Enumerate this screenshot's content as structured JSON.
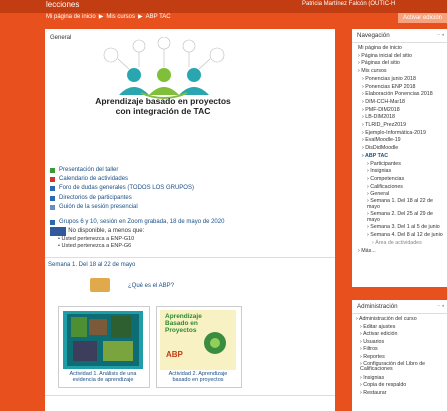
{
  "header": {
    "site_name": "lecciones",
    "user_name": "Patricia Martínez Falcón (OUTIC-H",
    "edit_button": "Activar edición",
    "breadcrumb": [
      "Mi página de inicio",
      "▶",
      "Mis cursos",
      "▶",
      "ABP TAC"
    ]
  },
  "main": {
    "general_title": "General",
    "hero_title_line1": "Aprendizaje basado en proyectos",
    "hero_title_line2": "con integración de TAC",
    "activities": [
      {
        "label": "Presentación del taller",
        "icon": "green"
      },
      {
        "label": "Calendario de actividades",
        "icon": "red"
      },
      {
        "label": "Foro de dudas generales   (TODOS LOS GRUPOS)",
        "icon": "blue"
      },
      {
        "label": "Directorios de participantes",
        "icon": "blue"
      },
      {
        "label": "Guión de la sesión presencial",
        "icon": "blue"
      }
    ],
    "highlighted_line": "Grupos 6 y 10, sesión en Zoom grabada, 18 de mayo de 2020",
    "restricted_line": "No disponible, a menos que:",
    "restrictions": [
      "Usted pertenezca a ENP-G10",
      "Usted pertenezca a ENP-G6"
    ],
    "week_title": "Semana 1. Del 18 al 22 de mayo",
    "abp_question": "¿Qué es el ABP?",
    "card1_caption_line1": "Actividad 1. Análisis de una",
    "card1_caption_line2": "evidencia de aprendizaje",
    "card2_caption_line1": "Actividad 2. Aprendizaje",
    "card2_caption_line2": "basado en proyectos",
    "card2_title_line1": "Aprendizaje",
    "card2_title_line2": "Basado en",
    "card2_title_line3": "Proyectos",
    "card2_abp": "ABP"
  },
  "nav": {
    "title": "Navegación",
    "items": [
      {
        "label": "Mi página de inicio",
        "level": 1
      },
      {
        "label": "Página inicial del sitio",
        "level": 1
      },
      {
        "label": "Páginas del sitio",
        "level": 1
      },
      {
        "label": "Mis cursos",
        "level": 1
      },
      {
        "label": "Ponencias junio 2018",
        "level": 2
      },
      {
        "label": "Ponencias ENP 2018",
        "level": 2
      },
      {
        "label": "Elaboración Ponencias 2018",
        "level": 2
      },
      {
        "label": "DIM-CCH-Mar18",
        "level": 2
      },
      {
        "label": "PMF-DIM2018",
        "level": 2
      },
      {
        "label": "LB-DIM2018",
        "level": 2
      },
      {
        "label": "TLRID_Prez2019",
        "level": 2
      },
      {
        "label": "Ejemplo-Informática-2019",
        "level": 2
      },
      {
        "label": "EvalMoodle-19",
        "level": 2
      },
      {
        "label": "DisDidMoodle",
        "level": 2
      },
      {
        "label": "ABP TAC",
        "level": 2,
        "bold": true
      },
      {
        "label": "Participantes",
        "level": 3
      },
      {
        "label": "Insignias",
        "level": 3
      },
      {
        "label": "Competencias",
        "level": 3
      },
      {
        "label": "Calificaciones",
        "level": 3
      },
      {
        "label": "General",
        "level": 3
      },
      {
        "label": "Semana 1. Del 18 al 22 de mayo",
        "level": 3,
        "wrap": true
      },
      {
        "label": "Semana 2. Del 25 al 29 de mayo",
        "level": 3,
        "wrap": true
      },
      {
        "label": "Semana 3. Del 1 al 5 de junio",
        "level": 3,
        "wrap": true
      },
      {
        "label": "Semana 4. Del 8 al 12 de junio",
        "level": 3,
        "wrap": true
      },
      {
        "label": "Área de actividades",
        "level": 4,
        "grey": true
      },
      {
        "label": "Más...",
        "level": 1
      }
    ]
  },
  "admin": {
    "title": "Administración",
    "items": [
      {
        "label": "Administración del curso"
      },
      {
        "label": "Editar ajustes"
      },
      {
        "label": "Activar edición"
      },
      {
        "label": "Usuarios"
      },
      {
        "label": "Filtros"
      },
      {
        "label": "Reportes"
      },
      {
        "label": "Configuración del Libro de Calificaciones",
        "wrap": true
      },
      {
        "label": "Insignias"
      },
      {
        "label": "Copia de respaldo"
      },
      {
        "label": "Restaurar"
      }
    ]
  },
  "colors": {
    "brand": "#e8501d",
    "link": "#1a4f86",
    "hero_green": "#7fbf3a",
    "hero_teal": "#2aa6b0"
  }
}
